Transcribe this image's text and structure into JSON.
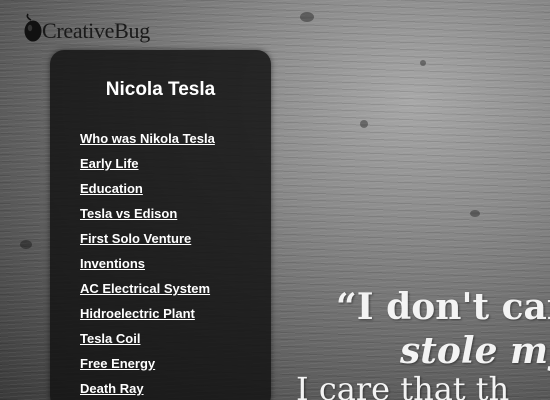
{
  "logo": {
    "text": "CreativeBug"
  },
  "sidebar": {
    "title": "Nicola Tesla",
    "items": [
      {
        "label": "Who was Nikola Tesla"
      },
      {
        "label": "Early Life"
      },
      {
        "label": "Education"
      },
      {
        "label": "Tesla vs Edison"
      },
      {
        "label": "First Solo Venture"
      },
      {
        "label": "Inventions"
      },
      {
        "label": "AC Electrical System"
      },
      {
        "label": "Hidroelectric Plant"
      },
      {
        "label": "Tesla Coil"
      },
      {
        "label": "Free Energy"
      },
      {
        "label": "Death Ray"
      }
    ]
  },
  "quote": {
    "line1": "“I don't car",
    "line2": "stole my",
    "line3": "I care that th"
  },
  "colors": {
    "sidebar_bg": "#141414",
    "link": "#ffffff",
    "quote_text": "#f3f3f3"
  }
}
